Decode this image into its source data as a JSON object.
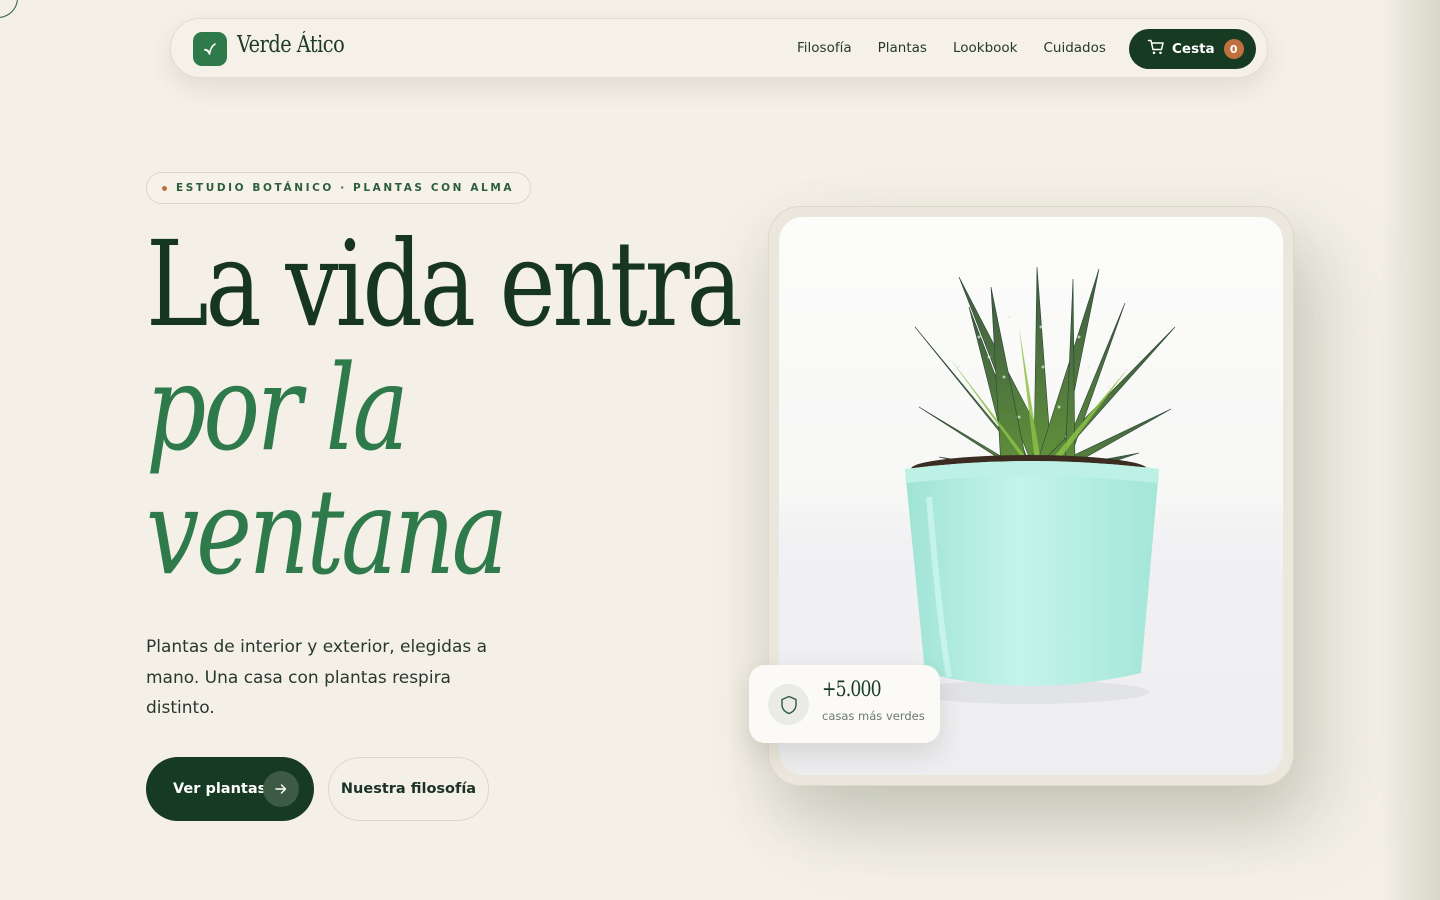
{
  "brand": {
    "name": "Verde Ático",
    "accent": "#2f7a4a",
    "dark": "#173a23",
    "highlight": "#c0703f"
  },
  "nav": {
    "links": [
      "Filosofía",
      "Plantas",
      "Lookbook",
      "Cuidados"
    ],
    "cart_label": "Cesta",
    "cart_count": "0",
    "cart_icon": "cart-icon"
  },
  "hero": {
    "eyebrow": "ESTUDIO BOTÁNICO · PLANTAS CON ALMA",
    "headline_line1": "La vida entra",
    "headline_line2": "por la",
    "headline_line3": "ventana",
    "subtitle": "Plantas de interior y exterior, elegidas a mano. Una casa con plantas respira distinto.",
    "primary_cta": "Ver plantas",
    "secondary_cta": "Nuestra filosofía"
  },
  "stat": {
    "value": "+5.000",
    "label": "casas más verdes",
    "icon": "shield-icon"
  }
}
